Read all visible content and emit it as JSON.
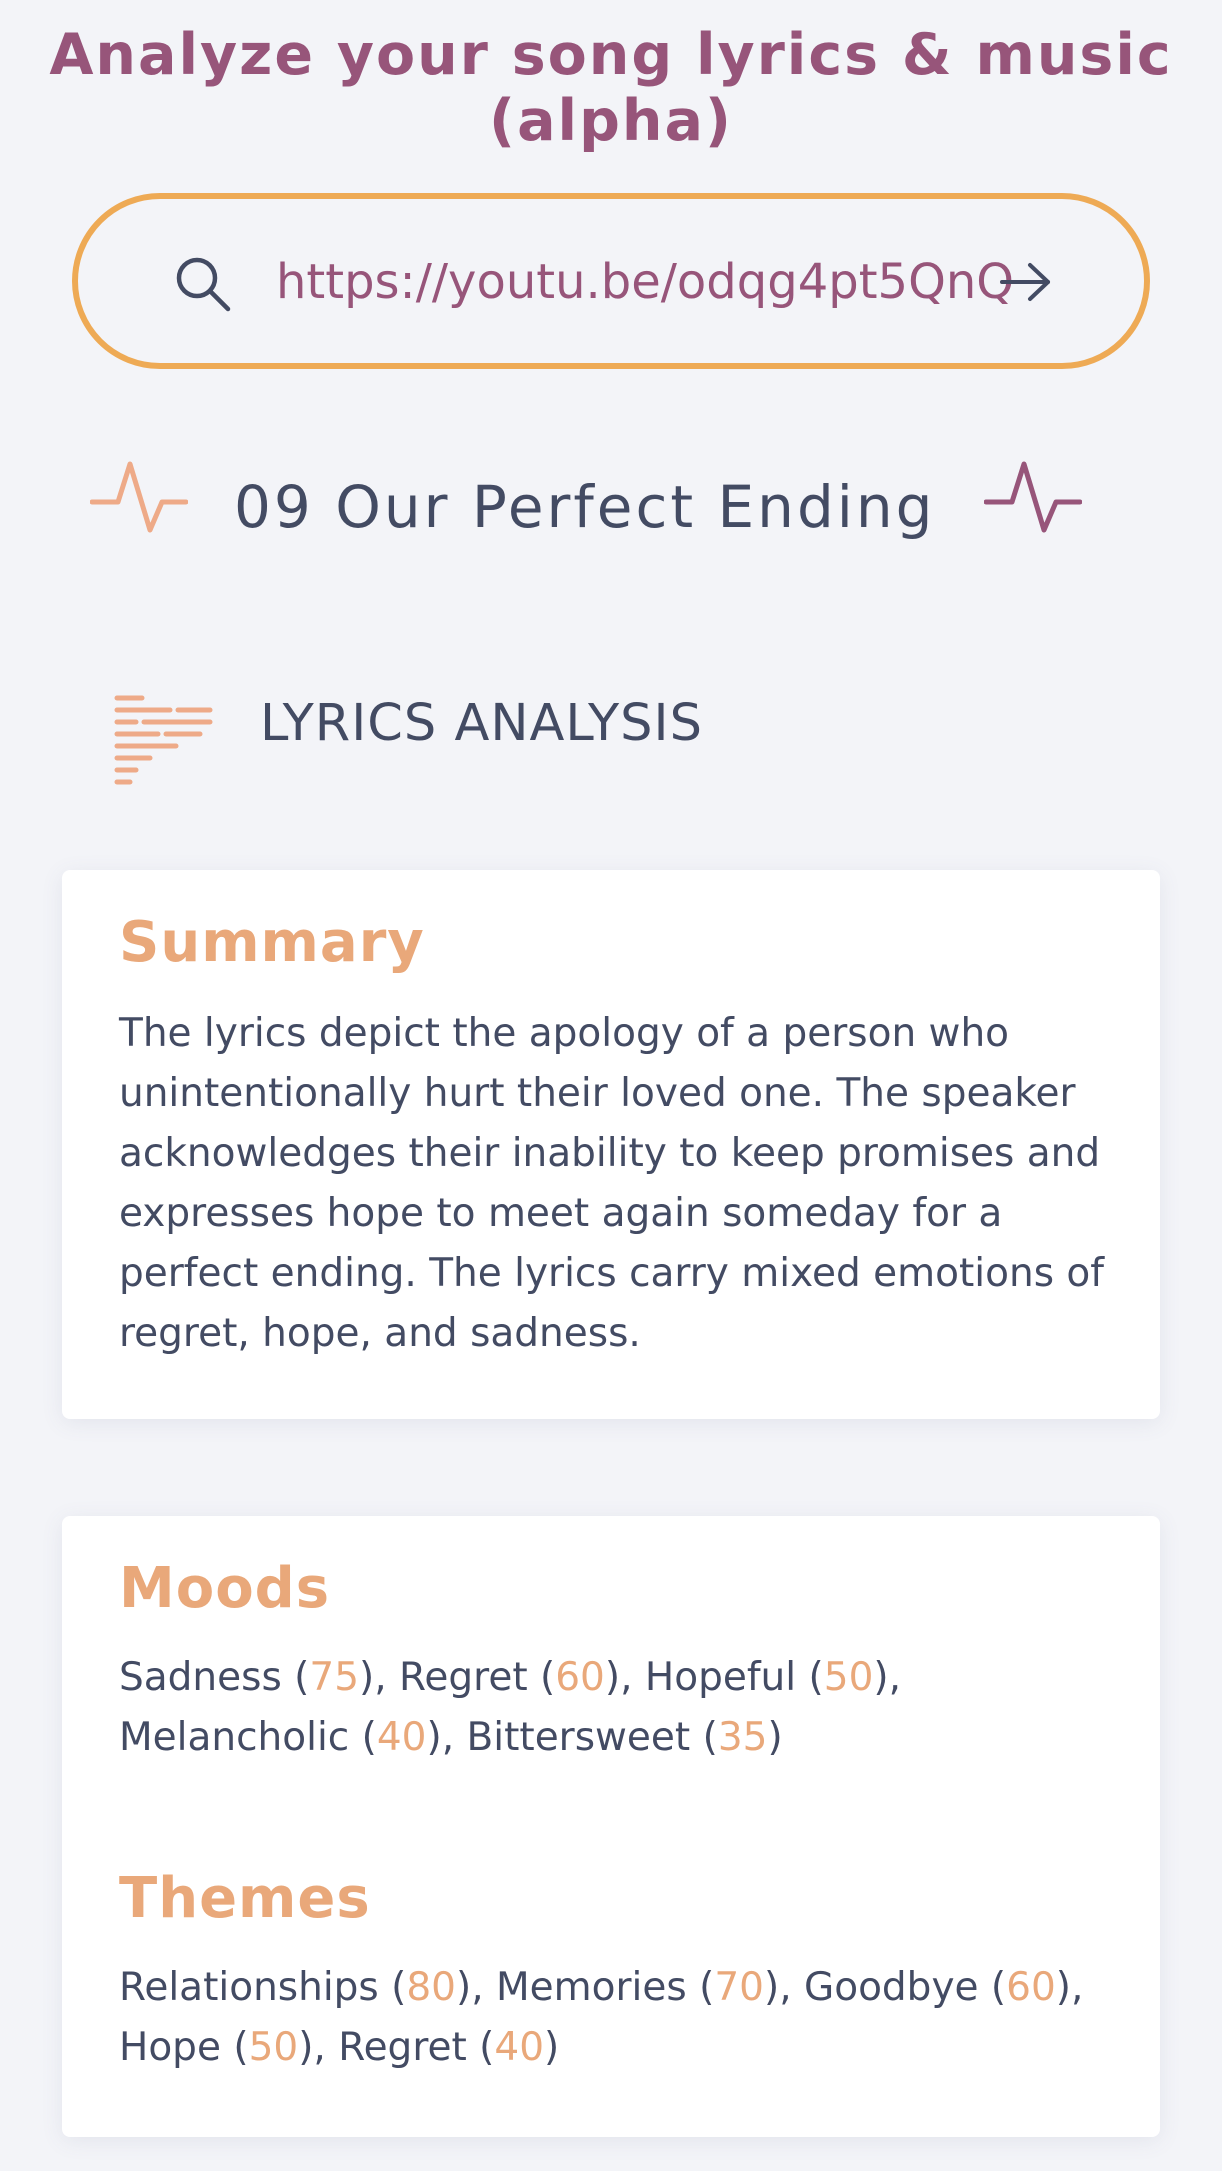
{
  "header": {
    "title": "Analyze your song lyrics & music (alpha)"
  },
  "search": {
    "value": "https://youtu.be/odqg4pt5QnQ",
    "icon": "search-icon",
    "submit_icon": "arrow-right-icon",
    "border_color": "#eeaa55"
  },
  "track": {
    "title": "09 Our Perfect Ending",
    "left_icon": "pulse-icon",
    "right_icon": "pulse-icon"
  },
  "section": {
    "title": "LYRICS ANALYSIS",
    "icon": "lyrics-lines-icon"
  },
  "summary": {
    "heading": "Summary",
    "text": "The lyrics depict the apology of a person who unintentionally hurt their loved one. The speaker acknowledges their inability to keep promises and expresses hope to meet again someday for a perfect ending. The lyrics carry mixed emotions of regret, hope, and sadness."
  },
  "moods": {
    "heading": "Moods",
    "items": [
      {
        "label": "Sadness",
        "score": "75"
      },
      {
        "label": "Regret",
        "score": "60"
      },
      {
        "label": "Hopeful",
        "score": "50"
      },
      {
        "label": "Melancholic",
        "score": "40"
      },
      {
        "label": "Bittersweet",
        "score": "35"
      }
    ]
  },
  "themes": {
    "heading": "Themes",
    "items": [
      {
        "label": "Relationships",
        "score": "80"
      },
      {
        "label": "Memories",
        "score": "70"
      },
      {
        "label": "Goodbye",
        "score": "60"
      },
      {
        "label": "Hope",
        "score": "50"
      },
      {
        "label": "Regret",
        "score": "40"
      }
    ]
  },
  "colors": {
    "title": "#97557a",
    "accent": "#e9a87a",
    "text": "#434b63",
    "background": "#f3f4f8"
  }
}
